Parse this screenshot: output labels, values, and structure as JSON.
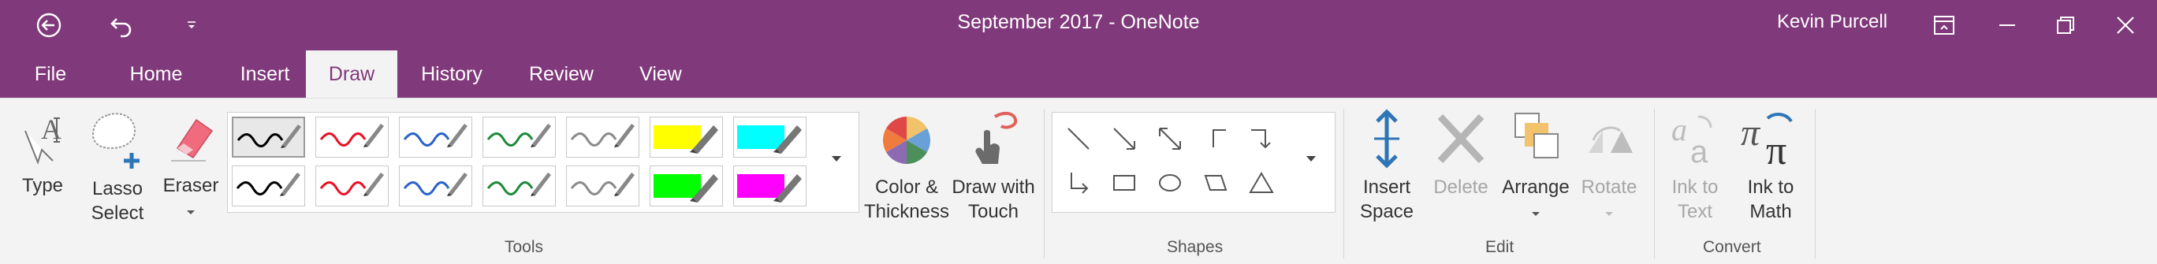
{
  "titlebar": {
    "title": "September 2017  -  OneNote",
    "user": "Kevin Purcell",
    "back_icon": "back-circle-icon",
    "undo_icon": "undo-icon",
    "qat_icon": "customize-qat-icon",
    "ribbon_display_icon": "ribbon-display-options-icon",
    "minimize_icon": "minimize-icon",
    "restore_icon": "restore-icon",
    "close_icon": "close-icon"
  },
  "tabs": [
    {
      "label": "File"
    },
    {
      "label": "Home"
    },
    {
      "label": "Insert"
    },
    {
      "label": "Draw",
      "active": true
    },
    {
      "label": "History"
    },
    {
      "label": "Review"
    },
    {
      "label": "View"
    }
  ],
  "tools": {
    "type": {
      "label": "Type",
      "icon": "type-cursor-icon"
    },
    "lasso": {
      "label": "Lasso\nSelect",
      "icon": "lasso-select-icon"
    },
    "eraser": {
      "label": "Eraser",
      "icon": "eraser-icon"
    },
    "pens": [
      {
        "color": "#000000",
        "kind": "pen"
      },
      {
        "color": "#e81123",
        "kind": "pen"
      },
      {
        "color": "#2a62c8",
        "kind": "pen"
      },
      {
        "color": "#1e8a3a",
        "kind": "pen"
      },
      {
        "color": "#8a8a8a",
        "kind": "pen"
      },
      {
        "color": "#ffff00",
        "kind": "highlighter"
      },
      {
        "color": "#00ffff",
        "kind": "highlighter"
      },
      {
        "color": "#000000",
        "kind": "pen"
      },
      {
        "color": "#e81123",
        "kind": "pen"
      },
      {
        "color": "#2a62c8",
        "kind": "pen"
      },
      {
        "color": "#1e8a3a",
        "kind": "pen"
      },
      {
        "color": "#8a8a8a",
        "kind": "pen"
      },
      {
        "color": "#00ff00",
        "kind": "highlighter"
      },
      {
        "color": "#ff00ff",
        "kind": "highlighter"
      }
    ],
    "color_thickness": {
      "label": "Color &\nThickness",
      "icon": "color-wheel-icon"
    },
    "draw_touch": {
      "label": "Draw with\nTouch",
      "icon": "draw-touch-icon"
    },
    "group_label": "Tools"
  },
  "shapes": {
    "items": [
      "line-icon",
      "arrow-icon",
      "double-arrow-icon",
      "corner-arrow-down-icon",
      "corner-arrow-down-right-icon",
      "corner-arrow-up-icon",
      "rectangle-icon",
      "ellipse-icon",
      "parallelogram-icon",
      "triangle-icon"
    ],
    "group_label": "Shapes"
  },
  "edit": {
    "insert_space": {
      "label": "Insert\nSpace",
      "icon": "insert-space-icon"
    },
    "delete": {
      "label": "Delete",
      "icon": "delete-x-icon",
      "disabled": true
    },
    "arrange": {
      "label": "Arrange",
      "icon": "arrange-icon"
    },
    "rotate": {
      "label": "Rotate",
      "icon": "rotate-icon",
      "disabled": true
    },
    "group_label": "Edit"
  },
  "convert": {
    "ink_to_text": {
      "label": "Ink to\nText",
      "icon": "ink-to-text-icon",
      "disabled": true
    },
    "ink_to_math": {
      "label": "Ink to\nMath",
      "icon": "ink-to-math-icon"
    },
    "group_label": "Convert"
  },
  "colors": {
    "accent": "#80397b",
    "ribbon_bg": "#f3f3f3"
  }
}
